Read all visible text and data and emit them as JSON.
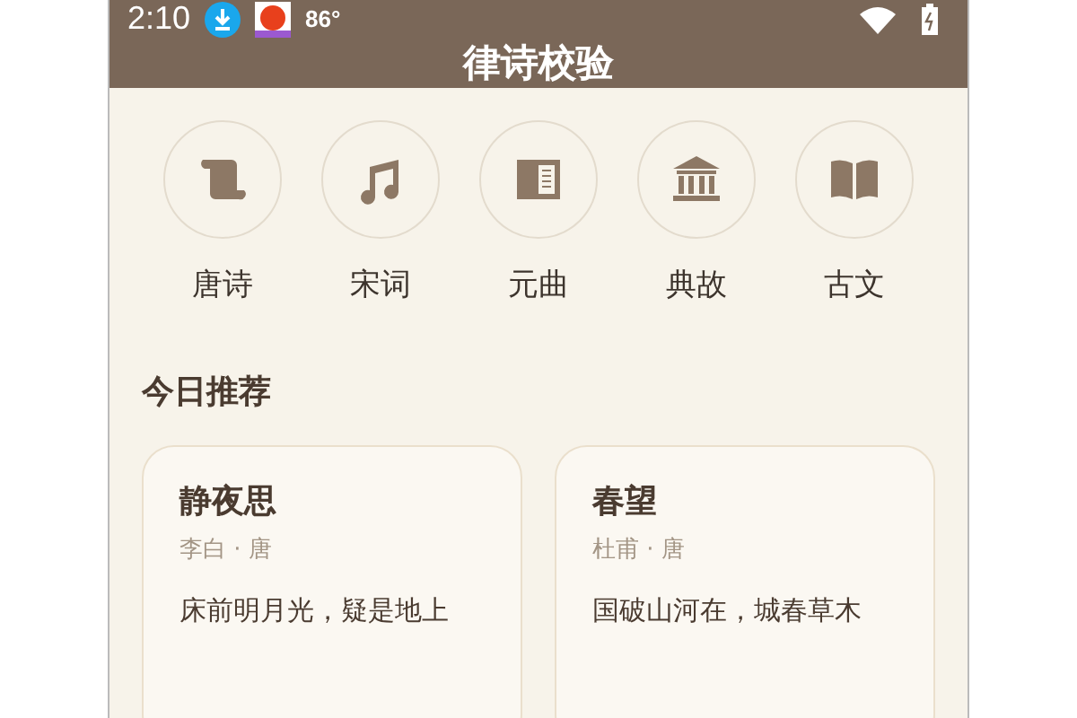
{
  "status_bar": {
    "time": "2:10",
    "temperature": "86°"
  },
  "app_bar": {
    "title": "律诗校验"
  },
  "categories": [
    {
      "kind": "scroll",
      "label": "唐诗"
    },
    {
      "kind": "music",
      "label": "宋词"
    },
    {
      "kind": "book",
      "label": "元曲"
    },
    {
      "kind": "bank",
      "label": "典故"
    },
    {
      "kind": "open-book",
      "label": "古文"
    }
  ],
  "section": {
    "title": "今日推荐"
  },
  "poems": [
    {
      "title": "静夜思",
      "author": "李白 · 唐",
      "line": "床前明月光，疑是地上"
    },
    {
      "title": "春望",
      "author": "杜甫 · 唐",
      "line": "国破山河在，城春草木"
    }
  ]
}
